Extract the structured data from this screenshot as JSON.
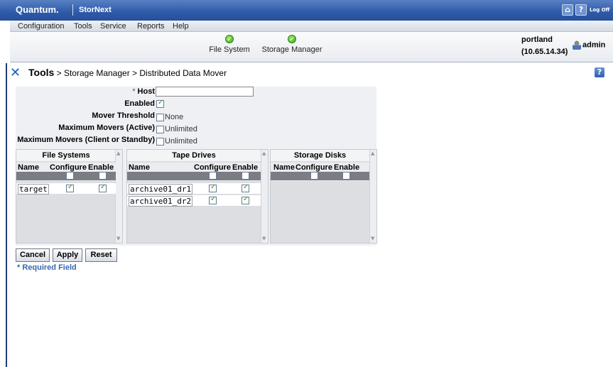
{
  "app": {
    "brand": "Quantum.",
    "product": "StorNext",
    "logoff_label": "Log Off"
  },
  "menu": [
    "Configuration",
    "Tools",
    "Service",
    "Reports",
    "Help"
  ],
  "toolbar": {
    "status": [
      {
        "label": "File System",
        "icon": "check-circle-icon"
      },
      {
        "label": "Storage Manager",
        "icon": "check-circle-icon"
      }
    ],
    "server_name": "portland",
    "server_ip": "(10.65.14.34)",
    "user": "admin"
  },
  "page": {
    "title_bold": "Tools",
    "breadcrumb": " > Storage Manager > Distributed Data Mover"
  },
  "form": {
    "host_label": "Host",
    "host_required_mark": "*",
    "host_value": "",
    "enabled_label": "Enabled",
    "enabled_checked": true,
    "mover_threshold_label": "Mover Threshold",
    "mover_threshold_option": "None",
    "max_active_label": "Maximum Movers (Active)",
    "max_active_option": "Unlimited",
    "max_client_label": "Maximum Movers (Client or Standby)",
    "max_client_option": "Unlimited"
  },
  "panels": {
    "file_systems": {
      "title": "File Systems",
      "col_name": "Name",
      "col_configure": "Configure",
      "col_enable": "Enable",
      "rows": [
        {
          "name": "target",
          "configure": true,
          "enable": true
        }
      ]
    },
    "tape_drives": {
      "title": "Tape Drives",
      "col_name": "Name",
      "col_configure": "Configure",
      "col_enable": "Enable",
      "rows": [
        {
          "name": "archive01_dr1",
          "configure": true,
          "enable": true
        },
        {
          "name": "archive01_dr2",
          "configure": true,
          "enable": true
        }
      ]
    },
    "storage_disks": {
      "title": "Storage Disks",
      "col_name": "Name",
      "col_configure": "Configure",
      "col_enable": "Enable"
    }
  },
  "buttons": {
    "cancel": "Cancel",
    "apply": "Apply",
    "reset": "Reset"
  },
  "footer": {
    "required_note": "* Required Field"
  }
}
